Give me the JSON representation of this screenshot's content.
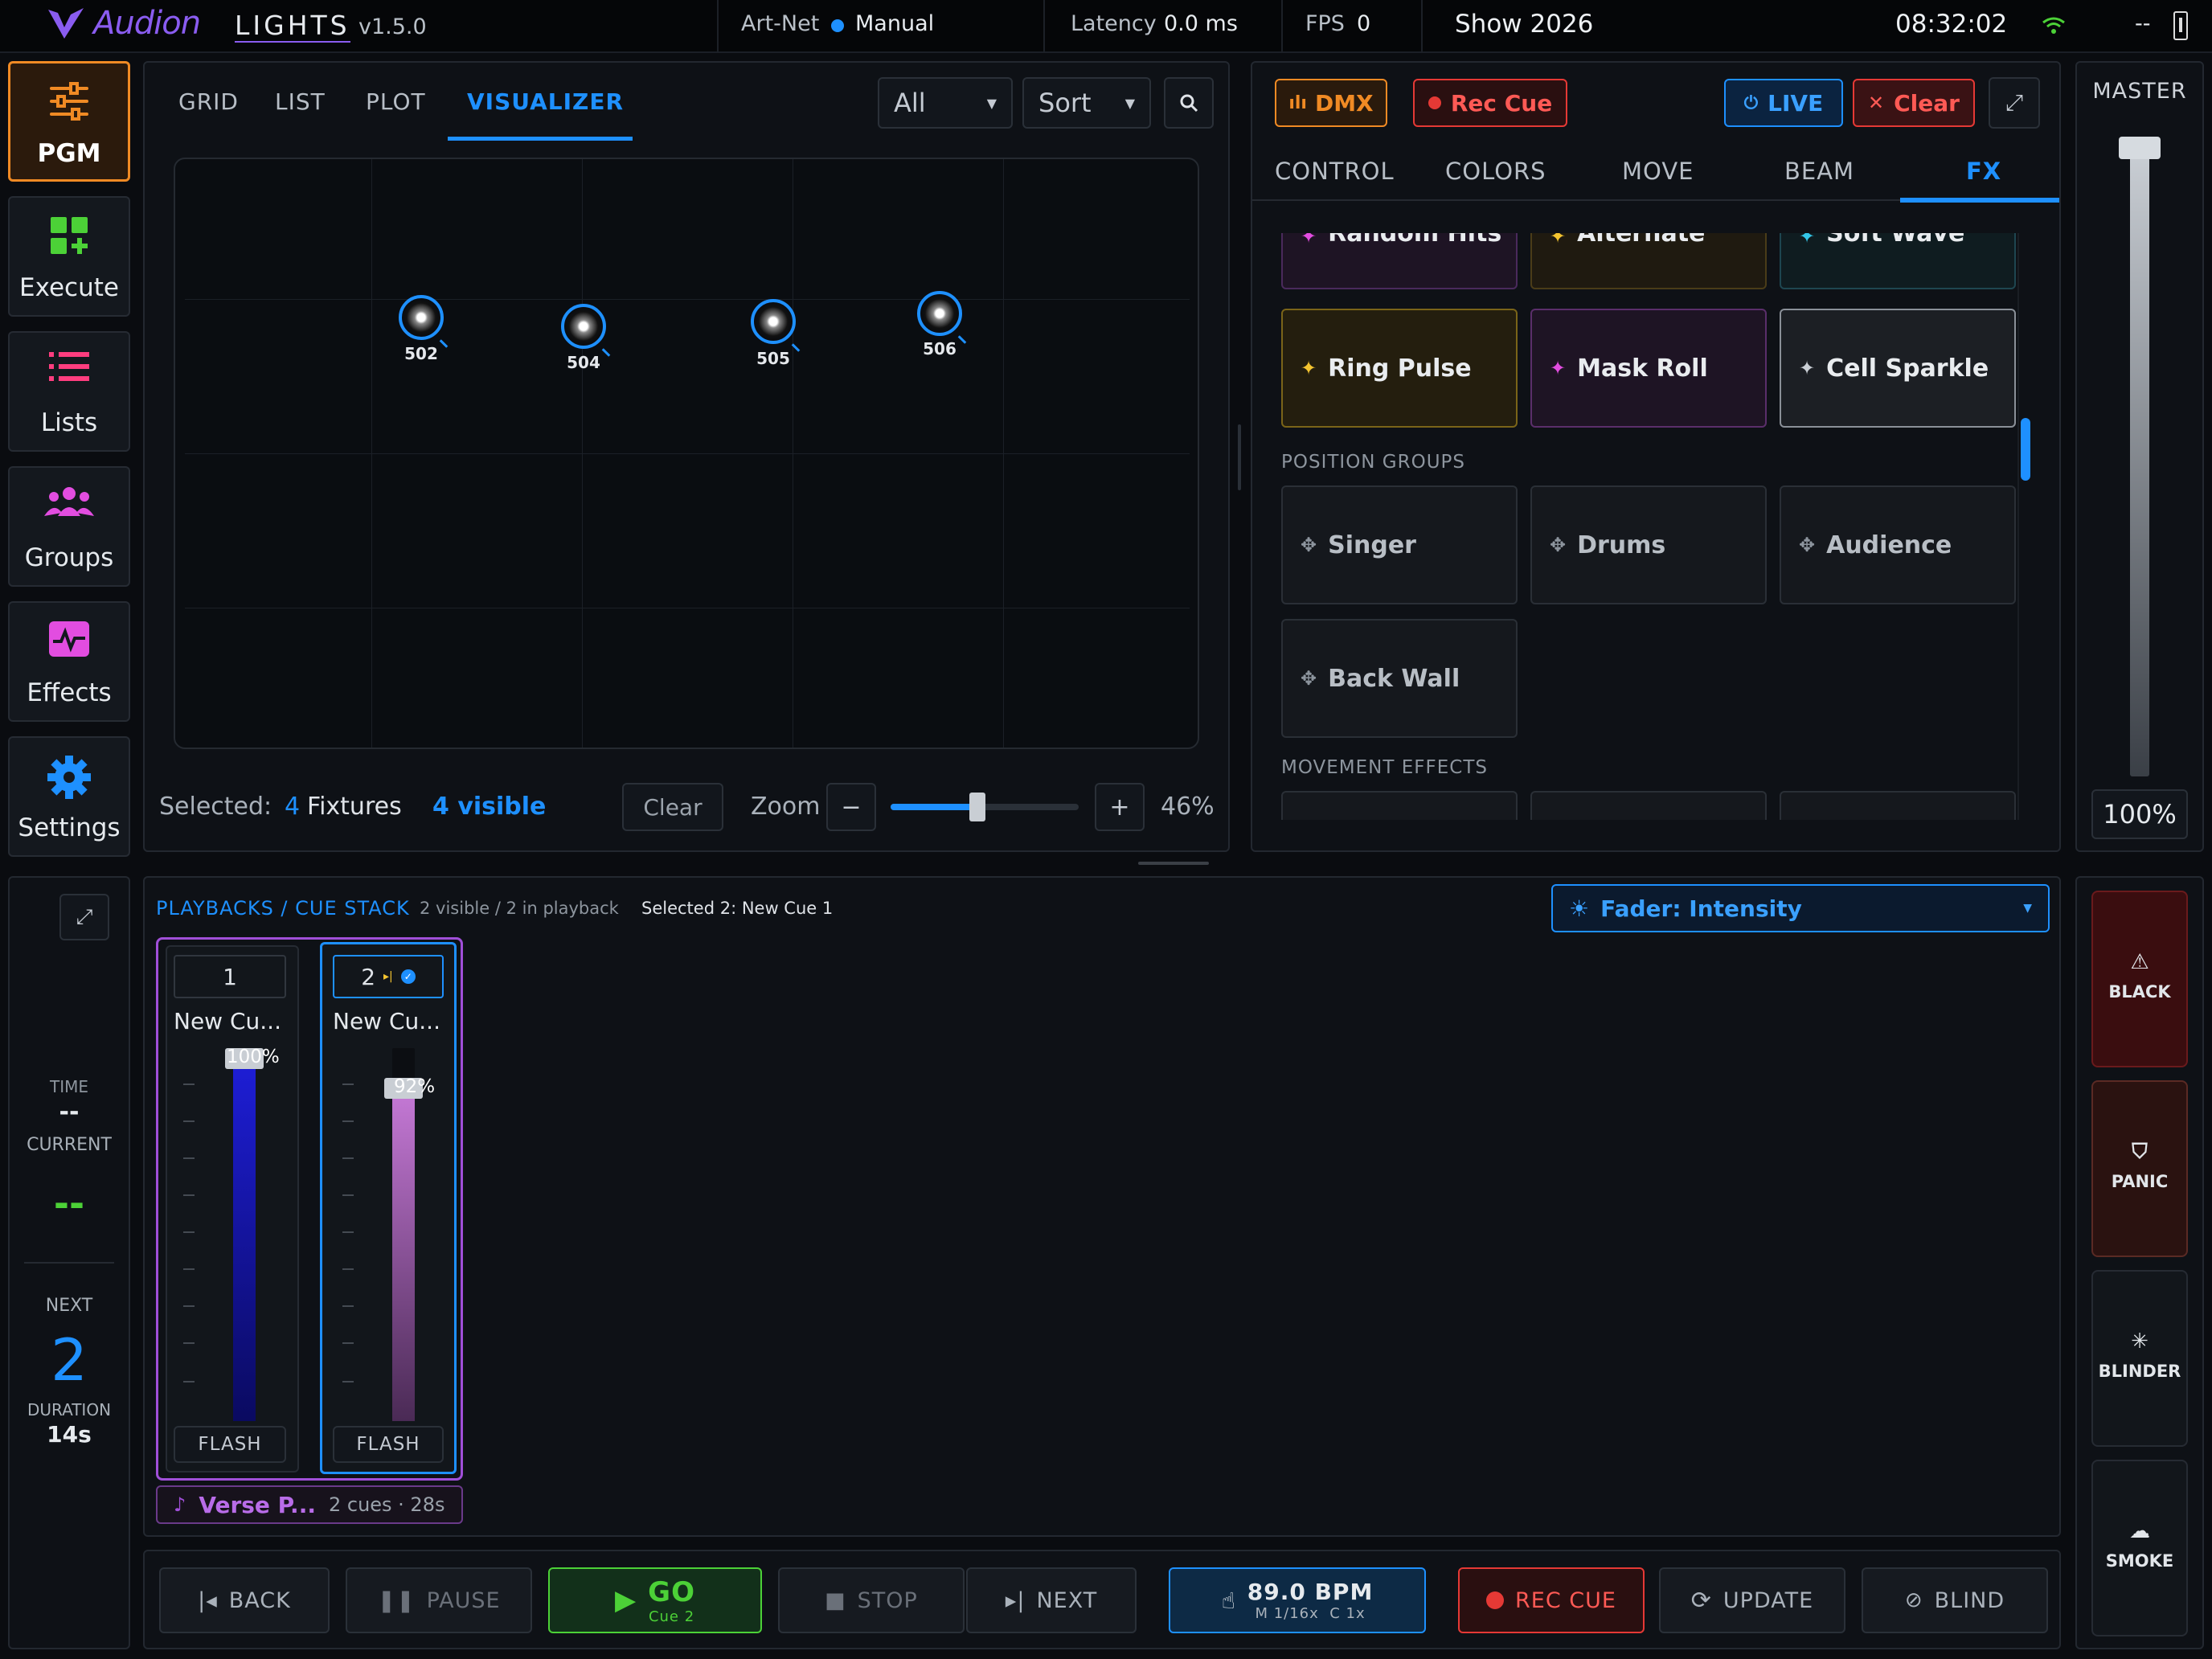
{
  "topbar": {
    "logo_brand": "Audion",
    "logo_product": "LIGHTS",
    "version": "v1.5.0",
    "artnet_label": "Art-Net",
    "artnet_mode": "Manual",
    "latency_label": "Latency",
    "latency_value": "0.0 ms",
    "fps_label": "FPS",
    "fps_value": "0",
    "show_name": "Show 2026",
    "clock": "08:32:02",
    "battery_text": "--"
  },
  "sidebar": {
    "items": [
      {
        "label": "PGM",
        "icon": "sliders-icon"
      },
      {
        "label": "Execute",
        "icon": "grid-plus-icon"
      },
      {
        "label": "Lists",
        "icon": "list-icon"
      },
      {
        "label": "Groups",
        "icon": "users-icon"
      },
      {
        "label": "Effects",
        "icon": "pulse-icon"
      },
      {
        "label": "Settings",
        "icon": "gear-icon"
      }
    ]
  },
  "viewer": {
    "tabs": [
      "GRID",
      "LIST",
      "PLOT",
      "VISUALIZER"
    ],
    "active_tab": "VISUALIZER",
    "filter_value": "All",
    "sort_value": "Sort",
    "fixtures": [
      "502",
      "504",
      "505",
      "506"
    ],
    "selected_label": "Selected:",
    "selected_count": "4",
    "selected_unit": "Fixtures",
    "visible_text": "4 visible",
    "clear_label": "Clear",
    "zoom_label": "Zoom",
    "zoom_minus": "−",
    "zoom_plus": "+",
    "zoom_value": "46%",
    "zoom_fraction": 0.46
  },
  "control": {
    "dmx_label": "DMX",
    "rec_cue_label": "Rec Cue",
    "live_label": "LIVE",
    "clear_label": "Clear",
    "tabs": [
      "CONTROL",
      "COLORS",
      "MOVE",
      "BEAM",
      "FX"
    ],
    "active_tab": "FX",
    "effects_partial": [
      "Random Hits",
      "Alternate",
      "Soft Wave"
    ],
    "effects": [
      "Ring Pulse",
      "Mask Roll",
      "Cell Sparkle"
    ],
    "position_groups_heading": "POSITION GROUPS",
    "position_groups": [
      "Singer",
      "Drums",
      "Audience",
      "Back Wall"
    ],
    "movement_heading": "MOVEMENT EFFECTS"
  },
  "master": {
    "label": "MASTER",
    "value": "100%",
    "level": 1.0
  },
  "playbacks": {
    "heading": "PLAYBACKS / CUE STACK",
    "counts": "2 visible / 2 in playback",
    "selected": "Selected 2: New Cue 1",
    "fader_select": "Fader: Intensity",
    "cues": [
      {
        "number": "1",
        "name": "New Cu...",
        "percent": "100%",
        "level": 1.0,
        "flash": "FLASH"
      },
      {
        "number": "2",
        "name": "New Cu...",
        "percent": "92%",
        "level": 0.92,
        "flash": "FLASH"
      }
    ],
    "group_name": "Verse P...",
    "group_meta": "2 cues · 28s"
  },
  "status": {
    "time_label": "TIME",
    "time_value": "--",
    "current_label": "CURRENT",
    "current_value": "--",
    "next_label": "NEXT",
    "next_value": "2",
    "duration_label": "DURATION",
    "duration_value": "14s"
  },
  "right_buttons": [
    "BLACK",
    "PANIC",
    "BLINDER",
    "SMOKE"
  ],
  "transport": {
    "back": "BACK",
    "pause": "PAUSE",
    "go": "GO",
    "go_sub": "Cue 2",
    "stop": "STOP",
    "next": "NEXT",
    "bpm": "89.0 BPM",
    "bpm_sub": "M 1/16x  C 1x",
    "rec_cue": "REC CUE",
    "update": "UPDATE",
    "blind": "BLIND"
  },
  "colors": {
    "accent_blue": "#1e90ff",
    "pgm_orange": "#f08a24",
    "go_green": "#4cd137",
    "rec_red": "#e53935",
    "purple": "#a04fd8"
  }
}
